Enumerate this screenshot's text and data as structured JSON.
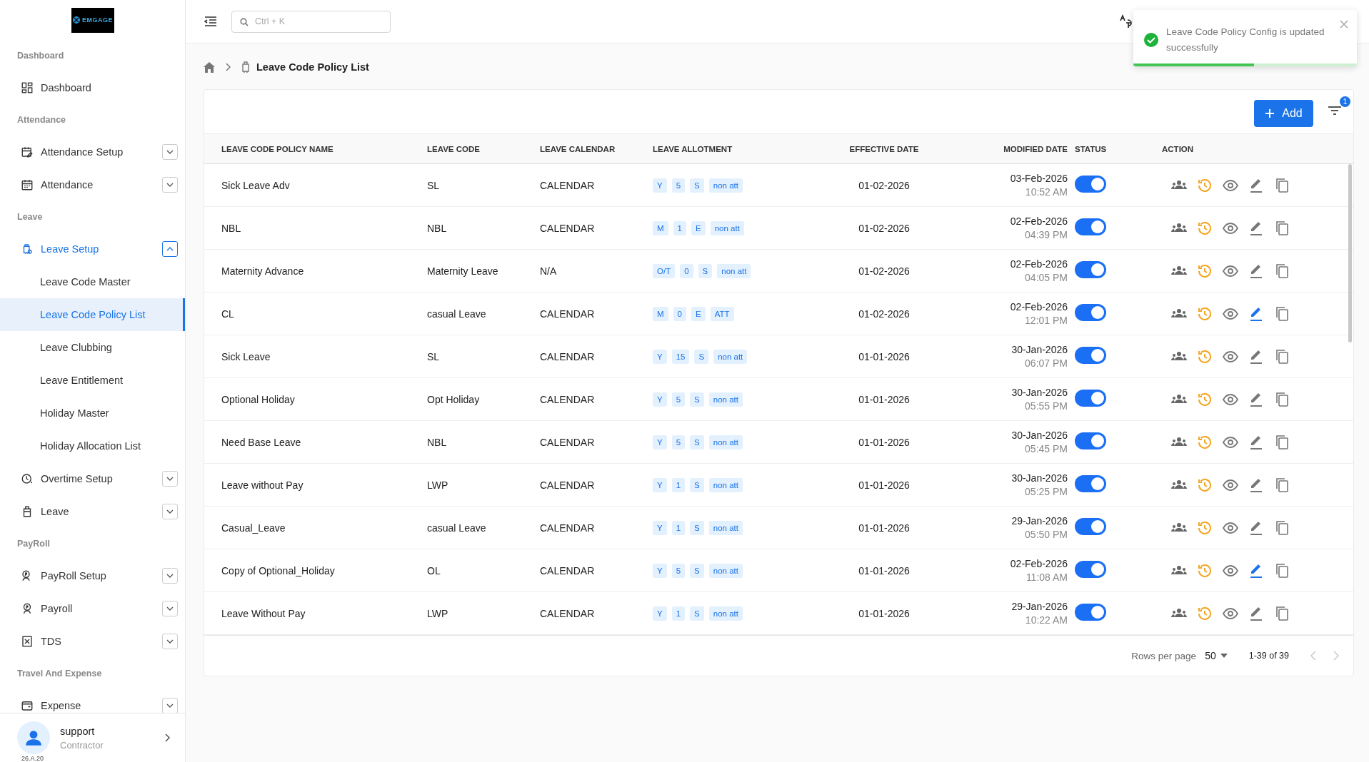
{
  "sidebar": {
    "logo": "EMGAGE",
    "sections": [
      {
        "label": "Dashboard",
        "items": [
          {
            "label": "Dashboard",
            "selected": false
          }
        ]
      },
      {
        "label": "Attendance",
        "items": [
          {
            "label": "Attendance Setup",
            "selected": false,
            "expanded": false
          },
          {
            "label": "Attendance",
            "selected": false,
            "expanded": false
          }
        ]
      },
      {
        "label": "Leave",
        "items": [
          {
            "label": "Leave Setup",
            "selected": true,
            "expanded": true,
            "children": [
              {
                "label": "Leave Code Master",
                "selected": false
              },
              {
                "label": "Leave Code Policy List",
                "selected": true
              },
              {
                "label": "Leave Clubbing",
                "selected": false
              },
              {
                "label": "Leave Entitlement",
                "selected": false
              },
              {
                "label": "Holiday Master",
                "selected": false
              },
              {
                "label": "Holiday Allocation List",
                "selected": false
              }
            ]
          },
          {
            "label": "Overtime Setup",
            "selected": false,
            "expanded": false
          },
          {
            "label": "Leave",
            "selected": false,
            "expanded": false
          }
        ]
      },
      {
        "label": "PayRoll",
        "items": [
          {
            "label": "PayRoll Setup",
            "selected": false,
            "expanded": false
          },
          {
            "label": "Payroll",
            "selected": false,
            "expanded": false
          },
          {
            "label": "TDS",
            "selected": false,
            "expanded": false
          }
        ]
      },
      {
        "label": "Travel And Expense",
        "items": [
          {
            "label": "Expense",
            "selected": false,
            "expanded": false
          }
        ]
      }
    ],
    "user": {
      "name": "support",
      "role": "Contractor",
      "version": "26.A.20"
    }
  },
  "topbar": {
    "search": {
      "placeholder": "Ctrl + K"
    }
  },
  "toast": {
    "message": "Leave Code Policy Config is updated successfully",
    "level": 0.54
  },
  "breadcrumb": {
    "current": "Leave Code Policy List"
  },
  "toolbar": {
    "add_label": "Add",
    "filter_count": "1"
  },
  "table": {
    "columns": [
      "LEAVE CODE POLICY NAME",
      "LEAVE CODE",
      "LEAVE CALENDAR",
      "LEAVE ALLOTMENT",
      "EFFECTIVE DATE",
      "MODIFIED DATE",
      "STATUS",
      "ACTION"
    ],
    "rows": [
      {
        "name": "Sick Leave Adv",
        "code": "SL",
        "calendar": "CALENDAR",
        "allotment": [
          "Y",
          "5",
          "S",
          "non att"
        ],
        "effective": "01-02-2026",
        "modified_date": "03-Feb-2026",
        "modified_time": "10:52 AM",
        "on": true,
        "edit_highlighted": false
      },
      {
        "name": "NBL",
        "code": "NBL",
        "calendar": "CALENDAR",
        "allotment": [
          "M",
          "1",
          "E",
          "non att"
        ],
        "effective": "01-02-2026",
        "modified_date": "02-Feb-2026",
        "modified_time": "04:39 PM",
        "on": true,
        "edit_highlighted": false
      },
      {
        "name": "Maternity Advance",
        "code": "Maternity Leave",
        "calendar": "N/A",
        "allotment": [
          "O/T",
          "0",
          "S",
          "non att"
        ],
        "effective": "01-02-2026",
        "modified_date": "02-Feb-2026",
        "modified_time": "04:05 PM",
        "on": true,
        "edit_highlighted": false
      },
      {
        "name": "CL",
        "code": "casual Leave",
        "calendar": "CALENDAR",
        "allotment": [
          "M",
          "0",
          "E",
          "ATT"
        ],
        "effective": "01-02-2026",
        "modified_date": "02-Feb-2026",
        "modified_time": "12:01 PM",
        "on": true,
        "edit_highlighted": true
      },
      {
        "name": "Sick Leave",
        "code": "SL",
        "calendar": "CALENDAR",
        "allotment": [
          "Y",
          "15",
          "S",
          "non att"
        ],
        "effective": "01-01-2026",
        "modified_date": "30-Jan-2026",
        "modified_time": "06:07 PM",
        "on": true,
        "edit_highlighted": false
      },
      {
        "name": "Optional Holiday",
        "code": "Opt Holiday",
        "calendar": "CALENDAR",
        "allotment": [
          "Y",
          "5",
          "S",
          "non att"
        ],
        "effective": "01-01-2026",
        "modified_date": "30-Jan-2026",
        "modified_time": "05:55 PM",
        "on": true,
        "edit_highlighted": false
      },
      {
        "name": "Need Base Leave",
        "code": "NBL",
        "calendar": "CALENDAR",
        "allotment": [
          "Y",
          "5",
          "S",
          "non att"
        ],
        "effective": "01-01-2026",
        "modified_date": "30-Jan-2026",
        "modified_time": "05:45 PM",
        "on": true,
        "edit_highlighted": false
      },
      {
        "name": "Leave without Pay",
        "code": "LWP",
        "calendar": "CALENDAR",
        "allotment": [
          "Y",
          "1",
          "S",
          "non att"
        ],
        "effective": "01-01-2026",
        "modified_date": "30-Jan-2026",
        "modified_time": "05:25 PM",
        "on": true,
        "edit_highlighted": false
      },
      {
        "name": "Casual_Leave",
        "code": "casual Leave",
        "calendar": "CALENDAR",
        "allotment": [
          "Y",
          "1",
          "S",
          "non att"
        ],
        "effective": "01-01-2026",
        "modified_date": "29-Jan-2026",
        "modified_time": "05:50 PM",
        "on": true,
        "edit_highlighted": false
      },
      {
        "name": "Copy of Optional_Holiday",
        "code": "OL",
        "calendar": "CALENDAR",
        "allotment": [
          "Y",
          "5",
          "S",
          "non att"
        ],
        "effective": "01-01-2026",
        "modified_date": "02-Feb-2026",
        "modified_time": "11:08 AM",
        "on": true,
        "edit_highlighted": true
      },
      {
        "name": "Leave Without Pay",
        "code": "LWP",
        "calendar": "CALENDAR",
        "allotment": [
          "Y",
          "1",
          "S",
          "non att"
        ],
        "effective": "01-01-2026",
        "modified_date": "29-Jan-2026",
        "modified_time": "10:22 AM",
        "on": true,
        "edit_highlighted": false
      }
    ]
  },
  "pagination": {
    "rows_per_page_label": "Rows per page",
    "rows_per_page": "50",
    "range": "1-39 of 39",
    "prev": {
      "disabled": true
    },
    "next": {
      "disabled": true
    }
  }
}
